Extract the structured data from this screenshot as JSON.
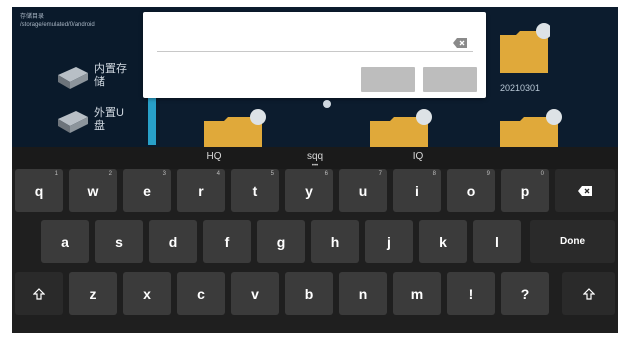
{
  "sidebar": {
    "path_text": "存储目录\n/storage/emulated/0/android",
    "items": [
      {
        "label": "内置存储",
        "icon": "hard-drive-icon"
      },
      {
        "label": "外置U盘",
        "icon": "hard-drive-icon"
      }
    ]
  },
  "content": {
    "folder_date": "20210301",
    "folder_icon": "folder-icon"
  },
  "dialog": {
    "input_value": "",
    "input_placeholder": "",
    "clear_icon": "backspace-icon",
    "button_1_label": "",
    "button_2_label": ""
  },
  "keyboard": {
    "suggestions": [
      "HQ",
      "sqq",
      "IQ"
    ],
    "suggestion_dots": "•••",
    "row1": [
      {
        "label": "q",
        "hint": "1"
      },
      {
        "label": "w",
        "hint": "2"
      },
      {
        "label": "e",
        "hint": "3"
      },
      {
        "label": "r",
        "hint": "4"
      },
      {
        "label": "t",
        "hint": "5"
      },
      {
        "label": "y",
        "hint": "6"
      },
      {
        "label": "u",
        "hint": "7"
      },
      {
        "label": "i",
        "hint": "8"
      },
      {
        "label": "o",
        "hint": "9"
      },
      {
        "label": "p",
        "hint": "0"
      }
    ],
    "backspace_icon": "backspace-icon",
    "row2": [
      "a",
      "s",
      "d",
      "f",
      "g",
      "h",
      "j",
      "k",
      "l"
    ],
    "done_label": "Done",
    "row3": [
      "z",
      "x",
      "c",
      "v",
      "b",
      "n",
      "m",
      "!",
      "?"
    ],
    "shift_icon": "shift-icon"
  },
  "colors": {
    "screen_bg": "#0c1c2e",
    "sidebar_accent": "#28a0c8",
    "folder": "#e0a93a",
    "key_bg": "#3b3b3b",
    "keyboard_bg": "#1f1f1f",
    "dialog_button": "#bdbdbd"
  }
}
